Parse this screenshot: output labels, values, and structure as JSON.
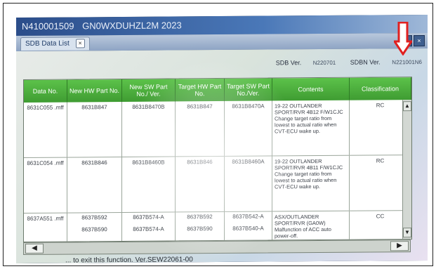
{
  "window": {
    "title_id": "N410001509",
    "title_vin": "GN0WXDUHZL2M 2023"
  },
  "tab": {
    "label": "SDB Data List",
    "close_glyph": "×"
  },
  "versions": {
    "sdb_label": "SDB Ver.",
    "sdb_value": "N220701",
    "sdbn_label": "SDBN Ver.",
    "sdbn_value": "N221001N6"
  },
  "table": {
    "headers": [
      "Data No.",
      "New HW Part No.",
      "New SW Part No./ Ver.",
      "Target HW Part No.",
      "Target SW Part No./Ver.",
      "Contents",
      "Classification"
    ],
    "rows": [
      {
        "data_no": "8631C055 .mff",
        "new_hw": "8631B847",
        "new_sw": "8631B8470B",
        "target_hw": "8631B847",
        "target_sw": "8631B8470A",
        "contents": "19-22 OUTLANDER SPORT/RVR 4B12 F/W1CJC Change target ratio from lowest to actual ratio when CVT-ECU wake up.",
        "classification": "RC"
      },
      {
        "data_no": "8631C054 .mff",
        "new_hw": "8631B846",
        "new_sw": "8631B8460B",
        "target_hw": "8631B846",
        "target_sw": "8631B8460A",
        "contents": "19-22 OUTLANDER SPORT/RVR 4B11 F/W1CJC Change target ratio from lowest to actual ratio when CVT-ECU wake up.",
        "classification": "RC"
      },
      {
        "data_no": "8637A551 .mff",
        "new_hw": "8637B592",
        "new_sw": "8637B574-A",
        "target_hw": "8637B592",
        "target_sw": "8637B542-A",
        "contents": "ASX/OUTLANDER SPORT/RVR (GA0W) Malfunction of ACC auto power-off.",
        "classification": "CC",
        "new_hw_2": "8637B590",
        "new_sw_2": "8637B574-A",
        "target_hw_2": "8637B590",
        "target_sw_2": "8637B540-A"
      }
    ]
  },
  "scroll": {
    "up_glyph": "▲",
    "down_glyph": "▼",
    "left_glyph": "◀",
    "right_glyph": "▶"
  },
  "status_text": "... to exit this function. Ver.SEW22061-00",
  "colors": {
    "header_green": "#4caf3c",
    "annotation_arrow": "#e02020"
  }
}
